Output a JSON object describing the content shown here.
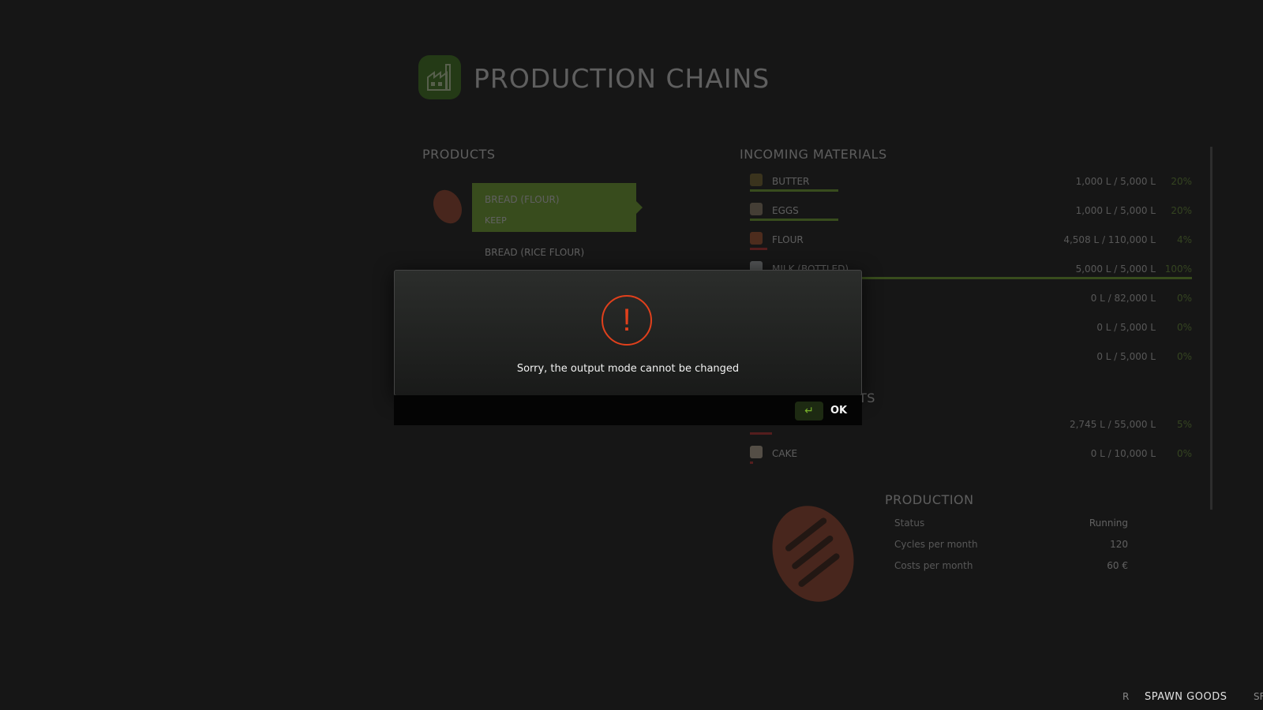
{
  "header": {
    "title": "PRODUCTION CHAINS",
    "icon": "factory-icon"
  },
  "products": {
    "title": "PRODUCTS",
    "items": [
      {
        "name": "BREAD (FLOUR)",
        "mode": "KEEP",
        "selected": true
      },
      {
        "name": "BREAD (RICE FLOUR)",
        "selected": false
      }
    ]
  },
  "incoming": {
    "title": "INCOMING MATERIALS",
    "items": [
      {
        "name": "BUTTER",
        "amount": "1,000 L / 5,000 L",
        "percent": "20%",
        "level": 0.2
      },
      {
        "name": "EGGS",
        "amount": "1,000 L / 5,000 L",
        "percent": "20%",
        "level": 0.2
      },
      {
        "name": "FLOUR",
        "amount": "4,508 L / 110,000 L",
        "percent": "4%",
        "level": 0.04
      },
      {
        "name": "MILK (BOTTLED)",
        "amount": "5,000 L / 5,000 L",
        "percent": "100%",
        "level": 1.0
      },
      {
        "name": "",
        "amount": "0 L / 82,000 L",
        "percent": "0%",
        "level": 0
      },
      {
        "name": "",
        "amount": "0 L / 5,000 L",
        "percent": "0%",
        "level": 0
      },
      {
        "name": "",
        "amount": "0 L / 5,000 L",
        "percent": "0%",
        "level": 0
      }
    ]
  },
  "outgoing": {
    "title_visible": "TS",
    "items": [
      {
        "name": "",
        "amount": "2,745 L / 55,000 L",
        "percent": "5%",
        "level": 0.05
      },
      {
        "name": "CAKE",
        "amount": "0 L / 10,000 L",
        "percent": "0%",
        "level": 0
      }
    ]
  },
  "production": {
    "title": "PRODUCTION",
    "rows": [
      {
        "label": "Status",
        "value": "Running"
      },
      {
        "label": "Cycles per month",
        "value": "120"
      },
      {
        "label": "Costs per month",
        "value": "60 €"
      }
    ]
  },
  "footer": {
    "key": "R",
    "label": "SPAWN GOODS",
    "next_key": "SF"
  },
  "modal": {
    "message": "Sorry, the output mode cannot be changed",
    "ok_label": "OK",
    "icon": "warning-icon",
    "ok_key_icon": "enter-key-icon"
  },
  "colors": {
    "accent": "#77b12a",
    "warning": "#e0401c",
    "bar_low": "#c72b2b"
  }
}
